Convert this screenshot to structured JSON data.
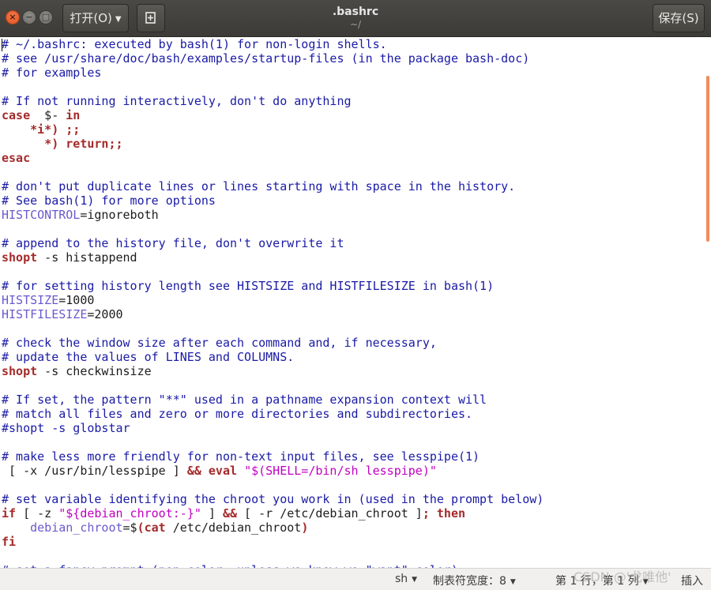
{
  "window": {
    "title": ".bashrc",
    "subtitle": "~/"
  },
  "toolbar": {
    "open_label": "打开(O)",
    "open_arrow": "▼",
    "new_icon": "new-document-icon",
    "save_label": "保存(S)"
  },
  "window_controls": {
    "close": "×",
    "minimize": "−",
    "maximize": "□"
  },
  "editor": {
    "lines": [
      [
        [
          "c",
          "# ~/.bashrc: executed by bash(1) for non-login shells."
        ]
      ],
      [
        [
          "c",
          "# see /usr/share/doc/bash/examples/startup-files (in the package bash-doc)"
        ]
      ],
      [
        [
          "c",
          "# for examples"
        ]
      ],
      [],
      [
        [
          "c",
          "# If not running interactively, don't do anything"
        ]
      ],
      [
        [
          "k",
          "case"
        ],
        [
          "",
          "  $- "
        ],
        [
          "k",
          "in"
        ]
      ],
      [
        [
          "",
          "    "
        ],
        [
          "k",
          "*i*) ;;"
        ]
      ],
      [
        [
          "",
          "      "
        ],
        [
          "k",
          "*) return;;"
        ]
      ],
      [
        [
          "k",
          "esac"
        ]
      ],
      [],
      [
        [
          "c",
          "# don't put duplicate lines or lines starting with space in the history."
        ]
      ],
      [
        [
          "c",
          "# See bash(1) for more options"
        ]
      ],
      [
        [
          "v",
          "HISTCONTROL"
        ],
        [
          "",
          "=ignoreboth"
        ]
      ],
      [],
      [
        [
          "c",
          "# append to the history file, don't overwrite it"
        ]
      ],
      [
        [
          "k",
          "shopt"
        ],
        [
          "",
          " -s histappend"
        ]
      ],
      [],
      [
        [
          "c",
          "# for setting history length see HISTSIZE and HISTFILESIZE in bash(1)"
        ]
      ],
      [
        [
          "v",
          "HISTSIZE"
        ],
        [
          "",
          "=1000"
        ]
      ],
      [
        [
          "v",
          "HISTFILESIZE"
        ],
        [
          "",
          "=2000"
        ]
      ],
      [],
      [
        [
          "c",
          "# check the window size after each command and, if necessary,"
        ]
      ],
      [
        [
          "c",
          "# update the values of LINES and COLUMNS."
        ]
      ],
      [
        [
          "k",
          "shopt"
        ],
        [
          "",
          " -s checkwinsize"
        ]
      ],
      [],
      [
        [
          "c",
          "# If set, the pattern \"**\" used in a pathname expansion context will"
        ]
      ],
      [
        [
          "c",
          "# match all files and zero or more directories and subdirectories."
        ]
      ],
      [
        [
          "c",
          "#shopt -s globstar"
        ]
      ],
      [],
      [
        [
          "c",
          "# make less more friendly for non-text input files, see lesspipe(1)"
        ]
      ],
      [
        [
          "",
          " [ -x /usr/bin/lesspipe ] "
        ],
        [
          "k",
          "&& eval"
        ],
        [
          "",
          " "
        ],
        [
          "s",
          "\"$(SHELL=/bin/sh lesspipe)\""
        ]
      ],
      [],
      [
        [
          "c",
          "# set variable identifying the chroot you work in (used in the prompt below)"
        ]
      ],
      [
        [
          "k",
          "if"
        ],
        [
          "",
          " [ -z "
        ],
        [
          "s",
          "\"${debian_chroot:-}\""
        ],
        [
          "",
          " ] "
        ],
        [
          "k",
          "&&"
        ],
        [
          "",
          " [ -r /etc/debian_chroot ]"
        ],
        [
          "k",
          ";"
        ],
        [
          "",
          " "
        ],
        [
          "k",
          "then"
        ]
      ],
      [
        [
          "",
          "    "
        ],
        [
          "v",
          "debian_chroot"
        ],
        [
          "",
          "=$"
        ],
        [
          "k",
          "(cat"
        ],
        [
          "",
          " /etc/debian_chroot"
        ],
        [
          "k",
          ")"
        ]
      ],
      [
        [
          "k",
          "fi"
        ]
      ],
      [],
      [
        [
          "c",
          "# set a fancy prompt (non-color, unless we know we \"want\" color)"
        ]
      ]
    ]
  },
  "statusbar": {
    "language": "sh",
    "tab_width": "制表符宽度：8",
    "position": "第 1 行，第 1 列",
    "mode": "插入",
    "watermark": "CSDN @'戈唯他'"
  }
}
